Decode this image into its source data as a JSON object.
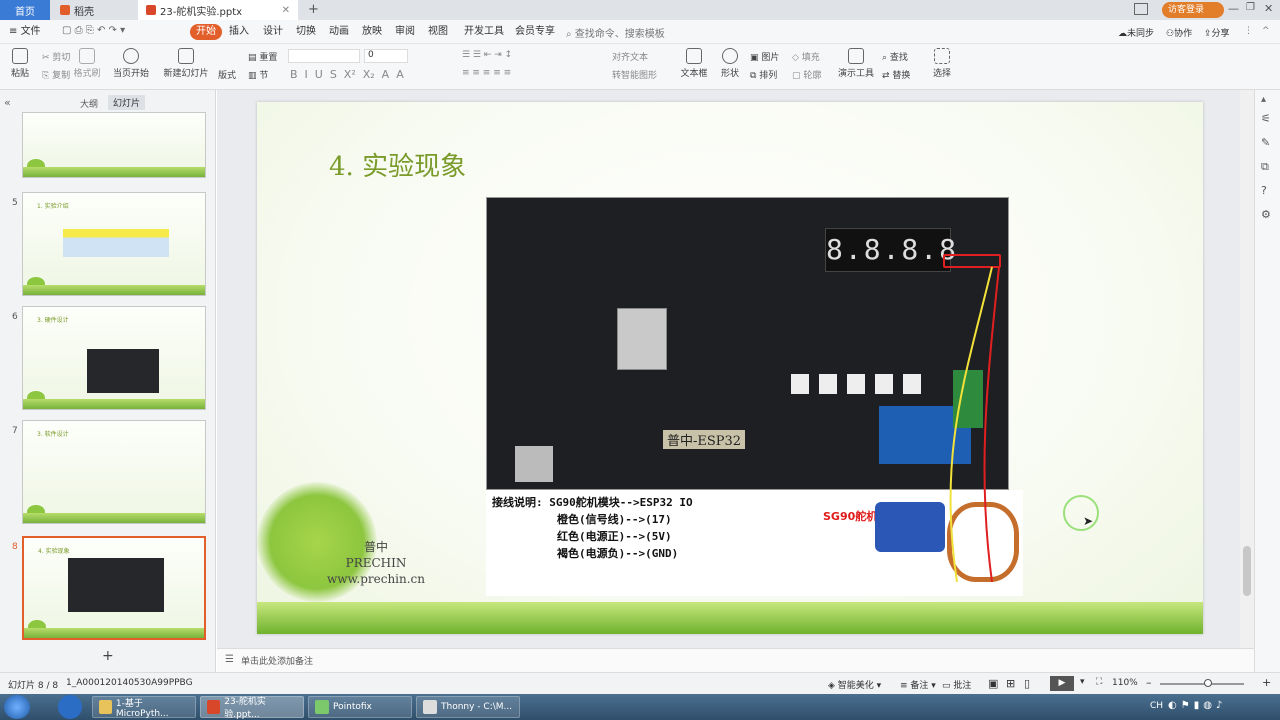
{
  "tabs": {
    "home": "首页",
    "daoke": "稻壳",
    "file": "23-舵机实验.pptx",
    "login": "访客登录"
  },
  "menu": {
    "file": "文件",
    "items": [
      "开始",
      "插入",
      "设计",
      "切换",
      "动画",
      "放映",
      "审阅",
      "视图",
      "开发工具",
      "会员专享"
    ],
    "search_placeholder": "查找命令、搜索模板",
    "unsync": "未同步",
    "collab": "协作",
    "share": "分享"
  },
  "ribbon": {
    "paste": "粘贴",
    "cut": "剪切",
    "copy": "复制",
    "format_painter": "格式刷",
    "play_from_current": "当页开始",
    "new_slide": "新建幻灯片",
    "layout": "版式",
    "section": "节",
    "reset": "重置",
    "font_size": "0",
    "text_align": "对齐文本",
    "smartart": "转智能图形",
    "textbox": "文本框",
    "shape": "形状",
    "arrange": "排列",
    "picture": "图片",
    "fill": "填充",
    "outline": "轮廓",
    "presenter_tools": "演示工具",
    "find": "查找",
    "replace": "替换",
    "select": "选择"
  },
  "left_pane": {
    "tab_outline": "大纲",
    "tab_slides": "幻灯片",
    "slides": [
      {
        "num": "5",
        "title": "1. 实验介绍"
      },
      {
        "num": "6",
        "title": "3. 硬件设计"
      },
      {
        "num": "7",
        "title": "3. 软件设计"
      },
      {
        "num": "8",
        "title": "4. 实验现象"
      }
    ],
    "add_slide": "+"
  },
  "slide": {
    "title": "4. 实验现象",
    "wiring_lines": [
      "接线说明: SG90舵机模块-->ESP32 IO",
      "橙色(信号线)-->(17)",
      "红色(电源正)-->(5V)",
      "褐色(电源负)-->(GND)"
    ],
    "sg90_label": "SG90舵机",
    "board_label": "普中-ESP32",
    "seg_display": "8.8.8.8",
    "watermark": [
      "普中",
      "PRECHIN",
      "www.prechin.cn"
    ]
  },
  "notes": {
    "placeholder": "单击此处添加备注"
  },
  "status": {
    "slide_counter": "幻灯片 8 / 8",
    "doc_id": "1_A000120140530A99PPBG",
    "smart_beautify": "智能美化",
    "notes": "备注",
    "comments": "批注",
    "zoom": "110%"
  },
  "taskbar": {
    "items": [
      "1-基于MicroPyth...",
      "23-舵机实验.ppt...",
      "Pointofix",
      "Thonny - C:\\M..."
    ],
    "lang": "CH"
  }
}
